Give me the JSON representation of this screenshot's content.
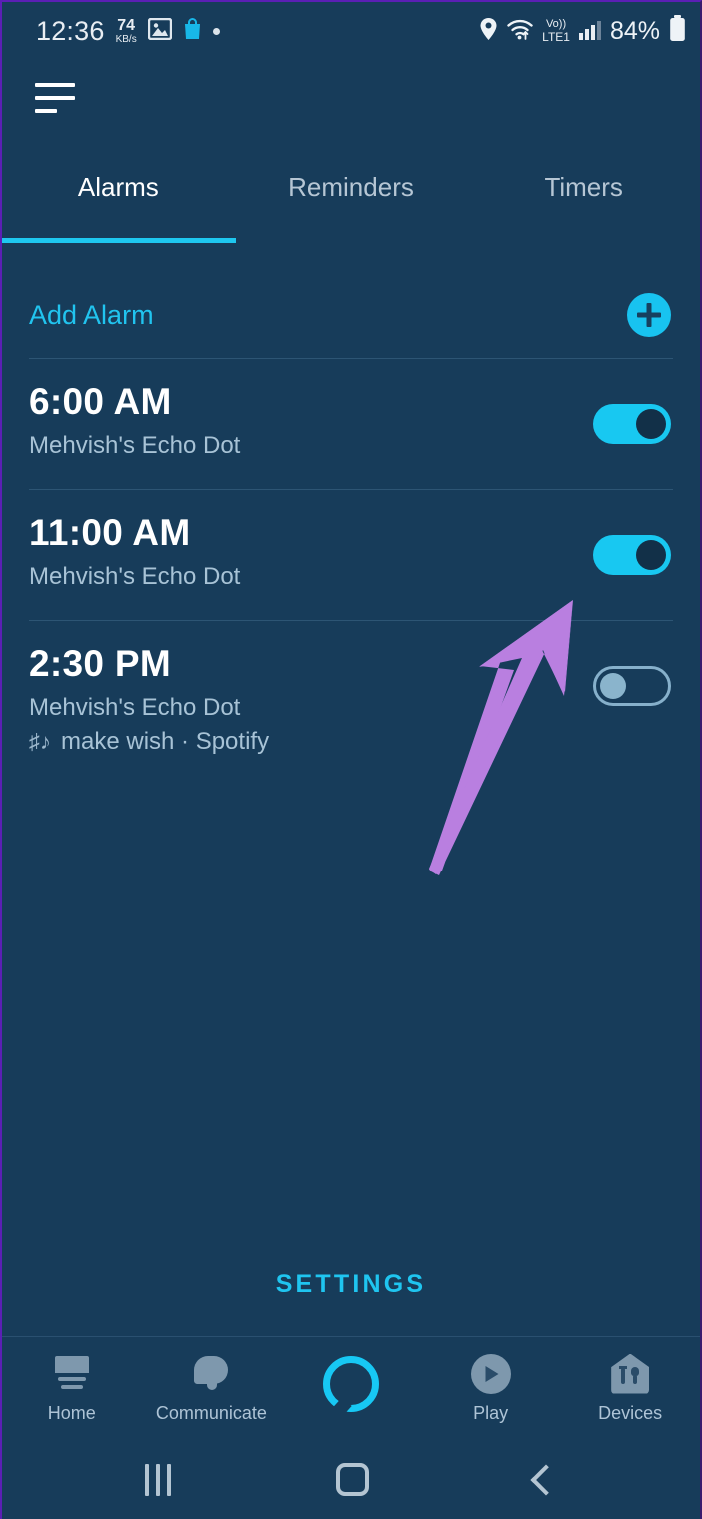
{
  "status_bar": {
    "time": "12:36",
    "net_speed_value": "74",
    "net_speed_unit": "KB/s",
    "icons": [
      "image-icon",
      "shopping-bag-icon",
      "dot-icon",
      "location-icon",
      "wifi-icon"
    ],
    "volte_top": "Vo))",
    "volte_bottom": "LTE1",
    "battery_percent": "84%"
  },
  "app_bar": {
    "menu_icon": "hamburger-menu-icon"
  },
  "tabs": {
    "active_index": 0,
    "items": [
      {
        "label": "Alarms"
      },
      {
        "label": "Reminders"
      },
      {
        "label": "Timers"
      }
    ],
    "accent_color": "#1ec8f0"
  },
  "add_alarm": {
    "label": "Add Alarm",
    "button_icon": "plus-icon"
  },
  "alarms": [
    {
      "time": "6:00 AM",
      "device": "Mehvish's Echo Dot",
      "music": null,
      "enabled": true
    },
    {
      "time": "11:00 AM",
      "device": "Mehvish's Echo Dot",
      "music": null,
      "enabled": true
    },
    {
      "time": "2:30 PM",
      "device": "Mehvish's Echo Dot",
      "music": "make wish · Spotify",
      "music_icon": "music-note-icon",
      "enabled": false
    }
  ],
  "settings": {
    "label": "SETTINGS",
    "color": "#1fc5f0"
  },
  "bottom_nav": {
    "items": [
      {
        "label": "Home",
        "icon": "home-icon"
      },
      {
        "label": "Communicate",
        "icon": "speech-bubble-icon"
      },
      {
        "label": "",
        "icon": "alexa-ring-icon"
      },
      {
        "label": "Play",
        "icon": "play-circle-icon"
      },
      {
        "label": "Devices",
        "icon": "devices-house-icon"
      }
    ]
  },
  "android_nav": {
    "recents": "recents-icon",
    "home": "home-square-icon",
    "back": "back-chevron-icon"
  },
  "annotation": {
    "arrow_color": "#b97fe0",
    "points_to": "alarm-toggle-11-00-am"
  },
  "theme": {
    "background": "#173c5a",
    "accent": "#18c8f1",
    "text_primary": "#ffffff",
    "text_secondary": "#a8c3d6"
  }
}
